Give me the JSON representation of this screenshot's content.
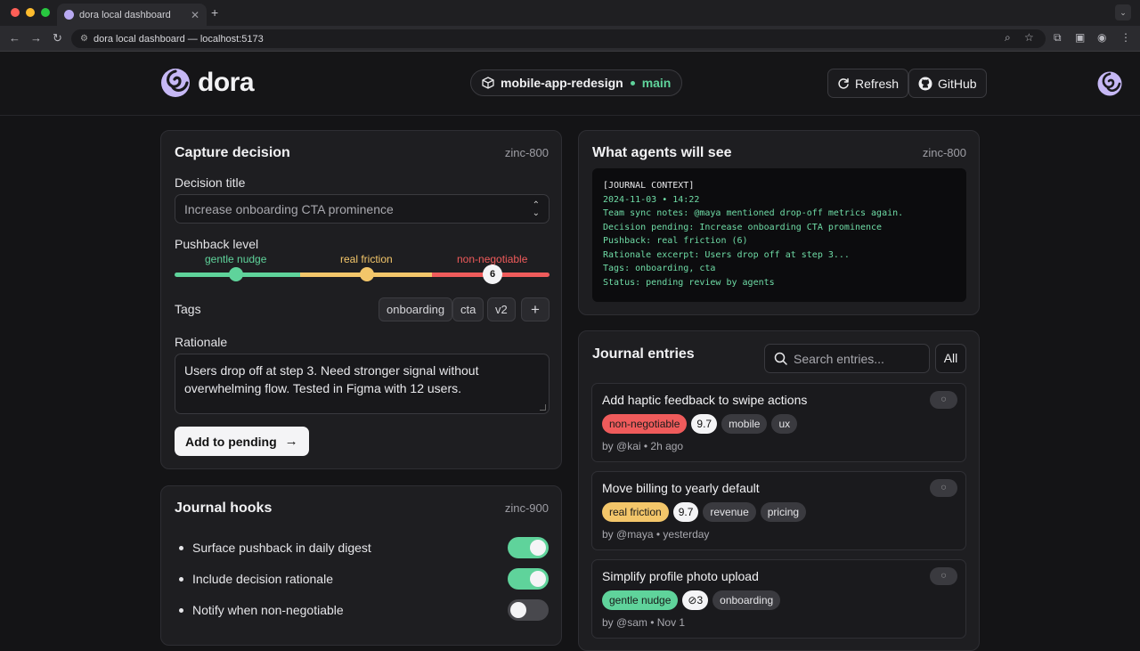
{
  "browser": {
    "tab_title": "dora local dashboard",
    "tab_close": "✕",
    "new_tab": "+",
    "url": "dora local dashboard — localhost:5173",
    "back_icon": "←",
    "forward_icon": "→",
    "reload_icon": "↻"
  },
  "header": {
    "logo_text": "dora",
    "project": "mobile-app-redesign",
    "branch": "main",
    "refresh_label": "Refresh",
    "github_label": "GitHub"
  },
  "capture": {
    "title": "Capture decision",
    "tag": "zinc-800",
    "decision_title_label": "Decision title",
    "decision_title_value": "Increase onboarding CTA prominence",
    "pushback_label": "Pushback level",
    "pushback_levels": [
      {
        "label": "gentle nudge",
        "color": "#5fd39b"
      },
      {
        "label": "real friction",
        "color": "#f3c66a"
      },
      {
        "label": "non-negotiable",
        "color": "#ef5b5b"
      }
    ],
    "pushback_value": 6,
    "tags_label": "Tags",
    "tags": [
      "onboarding",
      "cta",
      "v2"
    ],
    "add_tag": "+",
    "rationale_label": "Rationale",
    "rationale_value": "Users drop off at step 3. Need stronger signal without overwhelming flow. Tested in Figma with 12 users.",
    "submit_label": "Add to pending",
    "submit_icon": "→"
  },
  "hooks": {
    "title": "Journal hooks",
    "tag": "zinc-900",
    "items": [
      {
        "label": "Surface pushback in daily digest",
        "on": true
      },
      {
        "label": "Include decision rationale",
        "on": true
      },
      {
        "label": "Notify when non-negotiable",
        "on": false
      }
    ]
  },
  "agents": {
    "title": "What agents will see",
    "tag": "zinc-800",
    "lines": [
      {
        "text": "[JOURNAL CONTEXT]",
        "color": "#e8e8ea"
      },
      {
        "text": "2024-11-03 • 14:22",
        "color": "#6fdca6"
      },
      {
        "text": "Team sync notes: @maya mentioned drop-off metrics again.",
        "color": "#6fdca6"
      },
      {
        "text": "Decision pending: Increase onboarding CTA prominence",
        "color": "#6fdca6"
      },
      {
        "text": "Pushback: real friction (6)",
        "color": "#6fdca6"
      },
      {
        "text": "Rationale excerpt: Users drop off at step 3...",
        "color": "#6fdca6"
      },
      {
        "text": "Tags: onboarding, cta",
        "color": "#6fdca6"
      },
      {
        "text": "Status: pending review by agents",
        "color": "#6fdca6"
      }
    ]
  },
  "journal": {
    "title": "Journal entries",
    "search_placeholder": "Search entries...",
    "filter_label": "All",
    "entries": [
      {
        "title": "Add haptic feedback to swipe actions",
        "level": "non-negotiable",
        "level_bg": "#ef5b5b",
        "level_fg": "#1a1a1a",
        "score": "9.7",
        "tags": [
          "mobile",
          "ux"
        ],
        "meta": "by @kai • 2h ago"
      },
      {
        "title": "Move billing to yearly default",
        "level": "real friction",
        "level_bg": "#f3c66a",
        "level_fg": "#1a1a1a",
        "score": "9.7",
        "tags": [
          "revenue",
          "pricing"
        ],
        "meta": "by @maya • yesterday"
      },
      {
        "title": "Simplify profile photo upload",
        "level": "gentle nudge",
        "level_bg": "#5fd39b",
        "level_fg": "#1a1a1a",
        "score": "⊘3",
        "tags": [
          "onboarding"
        ],
        "meta": "by @sam • Nov 1"
      }
    ]
  }
}
